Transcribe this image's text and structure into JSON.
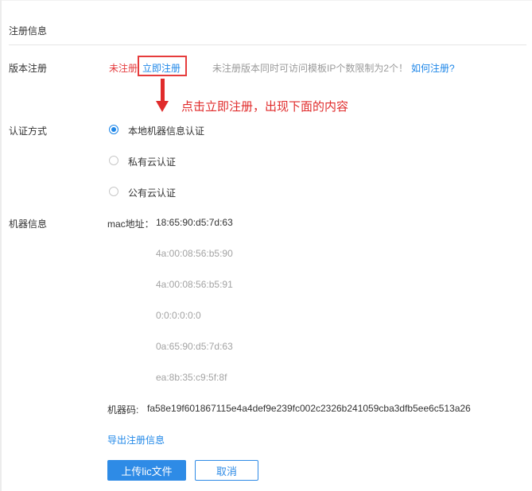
{
  "section": {
    "title": "注册信息"
  },
  "version": {
    "label": "版本注册",
    "status": "未注册",
    "register_link": "立即注册",
    "note": "未注册版本同时可访问模板IP个数限制为2个！",
    "help_link": "如何注册?"
  },
  "annotation": {
    "text": "点击立即注册，出现下面的内容"
  },
  "auth": {
    "label": "认证方式",
    "options": [
      {
        "label": "本地机器信息认证",
        "checked": true
      },
      {
        "label": "私有云认证",
        "checked": false
      },
      {
        "label": "公有云认证",
        "checked": false
      }
    ]
  },
  "machine": {
    "label": "机器信息",
    "mac_label": "mac地址：",
    "macs": [
      "18:65:90:d5:7d:63",
      "4a:00:08:56:b5:90",
      "4a:00:08:56:b5:91",
      "0:0:0:0:0:0",
      "0a:65:90:d5:7d:63",
      "ea:8b:35:c9:5f:8f"
    ],
    "code_label": "机器码:",
    "code_value": "fa58e19f601867115e4a4def9e239fc002c2326b241059cba3dfb5ee6c513a26",
    "export_link": "导出注册信息"
  },
  "buttons": {
    "upload": "上传lic文件",
    "cancel": "取消"
  },
  "colors": {
    "accent": "#1f87e8",
    "danger": "#e4393c",
    "annotation": "#e02b2b"
  }
}
